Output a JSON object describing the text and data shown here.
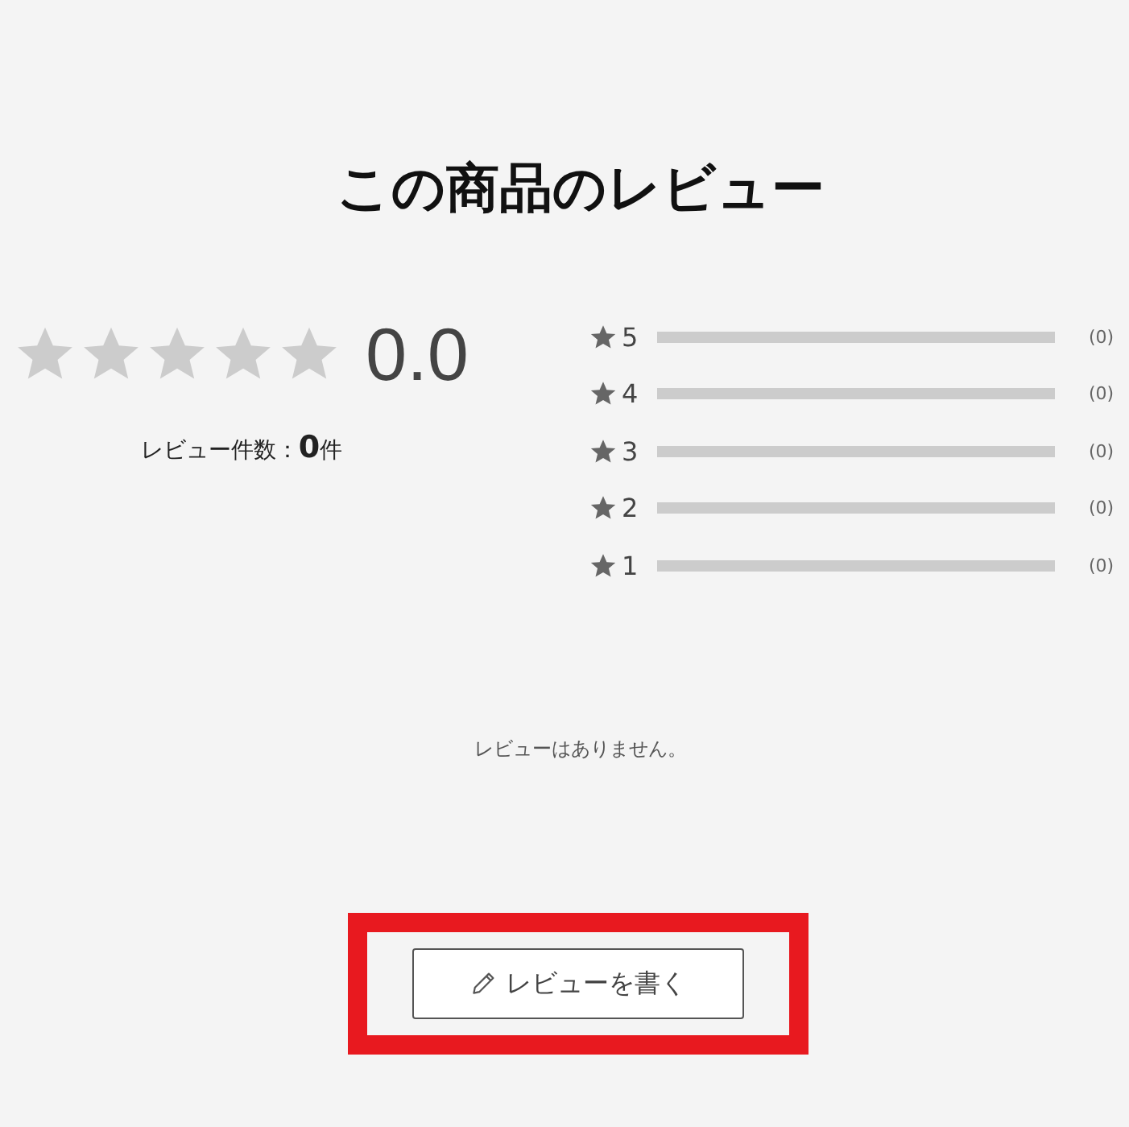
{
  "title": "この商品のレビュー",
  "summary": {
    "stars": 0,
    "score": "0.0",
    "count_text": "レビュー件数：**0**件"
  },
  "distribution": [
    {
      "label": "5",
      "level": 0,
      "count": "(0)"
    },
    {
      "label": "4",
      "level": 0,
      "count": "(0)"
    },
    {
      "label": "3",
      "level": 0,
      "count": "(0)"
    },
    {
      "label": "2",
      "level": 0,
      "count": "(0)"
    },
    {
      "label": "1",
      "level": 0,
      "count": "(0)"
    }
  ],
  "empty_message": "レビューはありません。",
  "write_button": {
    "label": "レビューを書く",
    "highlighted": true
  }
}
